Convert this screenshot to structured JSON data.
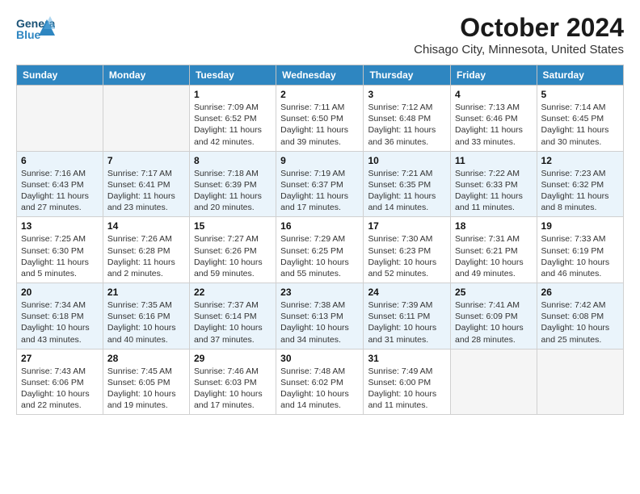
{
  "header": {
    "logo_line1": "General",
    "logo_line2": "Blue",
    "title": "October 2024",
    "subtitle": "Chisago City, Minnesota, United States"
  },
  "weekdays": [
    "Sunday",
    "Monday",
    "Tuesday",
    "Wednesday",
    "Thursday",
    "Friday",
    "Saturday"
  ],
  "weeks": [
    [
      {
        "day": "",
        "sunrise": "",
        "sunset": "",
        "daylight": "",
        "empty": true
      },
      {
        "day": "",
        "sunrise": "",
        "sunset": "",
        "daylight": "",
        "empty": true
      },
      {
        "day": "1",
        "sunrise": "Sunrise: 7:09 AM",
        "sunset": "Sunset: 6:52 PM",
        "daylight": "Daylight: 11 hours and 42 minutes."
      },
      {
        "day": "2",
        "sunrise": "Sunrise: 7:11 AM",
        "sunset": "Sunset: 6:50 PM",
        "daylight": "Daylight: 11 hours and 39 minutes."
      },
      {
        "day": "3",
        "sunrise": "Sunrise: 7:12 AM",
        "sunset": "Sunset: 6:48 PM",
        "daylight": "Daylight: 11 hours and 36 minutes."
      },
      {
        "day": "4",
        "sunrise": "Sunrise: 7:13 AM",
        "sunset": "Sunset: 6:46 PM",
        "daylight": "Daylight: 11 hours and 33 minutes."
      },
      {
        "day": "5",
        "sunrise": "Sunrise: 7:14 AM",
        "sunset": "Sunset: 6:45 PM",
        "daylight": "Daylight: 11 hours and 30 minutes."
      }
    ],
    [
      {
        "day": "6",
        "sunrise": "Sunrise: 7:16 AM",
        "sunset": "Sunset: 6:43 PM",
        "daylight": "Daylight: 11 hours and 27 minutes."
      },
      {
        "day": "7",
        "sunrise": "Sunrise: 7:17 AM",
        "sunset": "Sunset: 6:41 PM",
        "daylight": "Daylight: 11 hours and 23 minutes."
      },
      {
        "day": "8",
        "sunrise": "Sunrise: 7:18 AM",
        "sunset": "Sunset: 6:39 PM",
        "daylight": "Daylight: 11 hours and 20 minutes."
      },
      {
        "day": "9",
        "sunrise": "Sunrise: 7:19 AM",
        "sunset": "Sunset: 6:37 PM",
        "daylight": "Daylight: 11 hours and 17 minutes."
      },
      {
        "day": "10",
        "sunrise": "Sunrise: 7:21 AM",
        "sunset": "Sunset: 6:35 PM",
        "daylight": "Daylight: 11 hours and 14 minutes."
      },
      {
        "day": "11",
        "sunrise": "Sunrise: 7:22 AM",
        "sunset": "Sunset: 6:33 PM",
        "daylight": "Daylight: 11 hours and 11 minutes."
      },
      {
        "day": "12",
        "sunrise": "Sunrise: 7:23 AM",
        "sunset": "Sunset: 6:32 PM",
        "daylight": "Daylight: 11 hours and 8 minutes."
      }
    ],
    [
      {
        "day": "13",
        "sunrise": "Sunrise: 7:25 AM",
        "sunset": "Sunset: 6:30 PM",
        "daylight": "Daylight: 11 hours and 5 minutes."
      },
      {
        "day": "14",
        "sunrise": "Sunrise: 7:26 AM",
        "sunset": "Sunset: 6:28 PM",
        "daylight": "Daylight: 11 hours and 2 minutes."
      },
      {
        "day": "15",
        "sunrise": "Sunrise: 7:27 AM",
        "sunset": "Sunset: 6:26 PM",
        "daylight": "Daylight: 10 hours and 59 minutes."
      },
      {
        "day": "16",
        "sunrise": "Sunrise: 7:29 AM",
        "sunset": "Sunset: 6:25 PM",
        "daylight": "Daylight: 10 hours and 55 minutes."
      },
      {
        "day": "17",
        "sunrise": "Sunrise: 7:30 AM",
        "sunset": "Sunset: 6:23 PM",
        "daylight": "Daylight: 10 hours and 52 minutes."
      },
      {
        "day": "18",
        "sunrise": "Sunrise: 7:31 AM",
        "sunset": "Sunset: 6:21 PM",
        "daylight": "Daylight: 10 hours and 49 minutes."
      },
      {
        "day": "19",
        "sunrise": "Sunrise: 7:33 AM",
        "sunset": "Sunset: 6:19 PM",
        "daylight": "Daylight: 10 hours and 46 minutes."
      }
    ],
    [
      {
        "day": "20",
        "sunrise": "Sunrise: 7:34 AM",
        "sunset": "Sunset: 6:18 PM",
        "daylight": "Daylight: 10 hours and 43 minutes."
      },
      {
        "day": "21",
        "sunrise": "Sunrise: 7:35 AM",
        "sunset": "Sunset: 6:16 PM",
        "daylight": "Daylight: 10 hours and 40 minutes."
      },
      {
        "day": "22",
        "sunrise": "Sunrise: 7:37 AM",
        "sunset": "Sunset: 6:14 PM",
        "daylight": "Daylight: 10 hours and 37 minutes."
      },
      {
        "day": "23",
        "sunrise": "Sunrise: 7:38 AM",
        "sunset": "Sunset: 6:13 PM",
        "daylight": "Daylight: 10 hours and 34 minutes."
      },
      {
        "day": "24",
        "sunrise": "Sunrise: 7:39 AM",
        "sunset": "Sunset: 6:11 PM",
        "daylight": "Daylight: 10 hours and 31 minutes."
      },
      {
        "day": "25",
        "sunrise": "Sunrise: 7:41 AM",
        "sunset": "Sunset: 6:09 PM",
        "daylight": "Daylight: 10 hours and 28 minutes."
      },
      {
        "day": "26",
        "sunrise": "Sunrise: 7:42 AM",
        "sunset": "Sunset: 6:08 PM",
        "daylight": "Daylight: 10 hours and 25 minutes."
      }
    ],
    [
      {
        "day": "27",
        "sunrise": "Sunrise: 7:43 AM",
        "sunset": "Sunset: 6:06 PM",
        "daylight": "Daylight: 10 hours and 22 minutes."
      },
      {
        "day": "28",
        "sunrise": "Sunrise: 7:45 AM",
        "sunset": "Sunset: 6:05 PM",
        "daylight": "Daylight: 10 hours and 19 minutes."
      },
      {
        "day": "29",
        "sunrise": "Sunrise: 7:46 AM",
        "sunset": "Sunset: 6:03 PM",
        "daylight": "Daylight: 10 hours and 17 minutes."
      },
      {
        "day": "30",
        "sunrise": "Sunrise: 7:48 AM",
        "sunset": "Sunset: 6:02 PM",
        "daylight": "Daylight: 10 hours and 14 minutes."
      },
      {
        "day": "31",
        "sunrise": "Sunrise: 7:49 AM",
        "sunset": "Sunset: 6:00 PM",
        "daylight": "Daylight: 10 hours and 11 minutes."
      },
      {
        "day": "",
        "sunrise": "",
        "sunset": "",
        "daylight": "",
        "empty": true
      },
      {
        "day": "",
        "sunrise": "",
        "sunset": "",
        "daylight": "",
        "empty": true
      }
    ]
  ]
}
